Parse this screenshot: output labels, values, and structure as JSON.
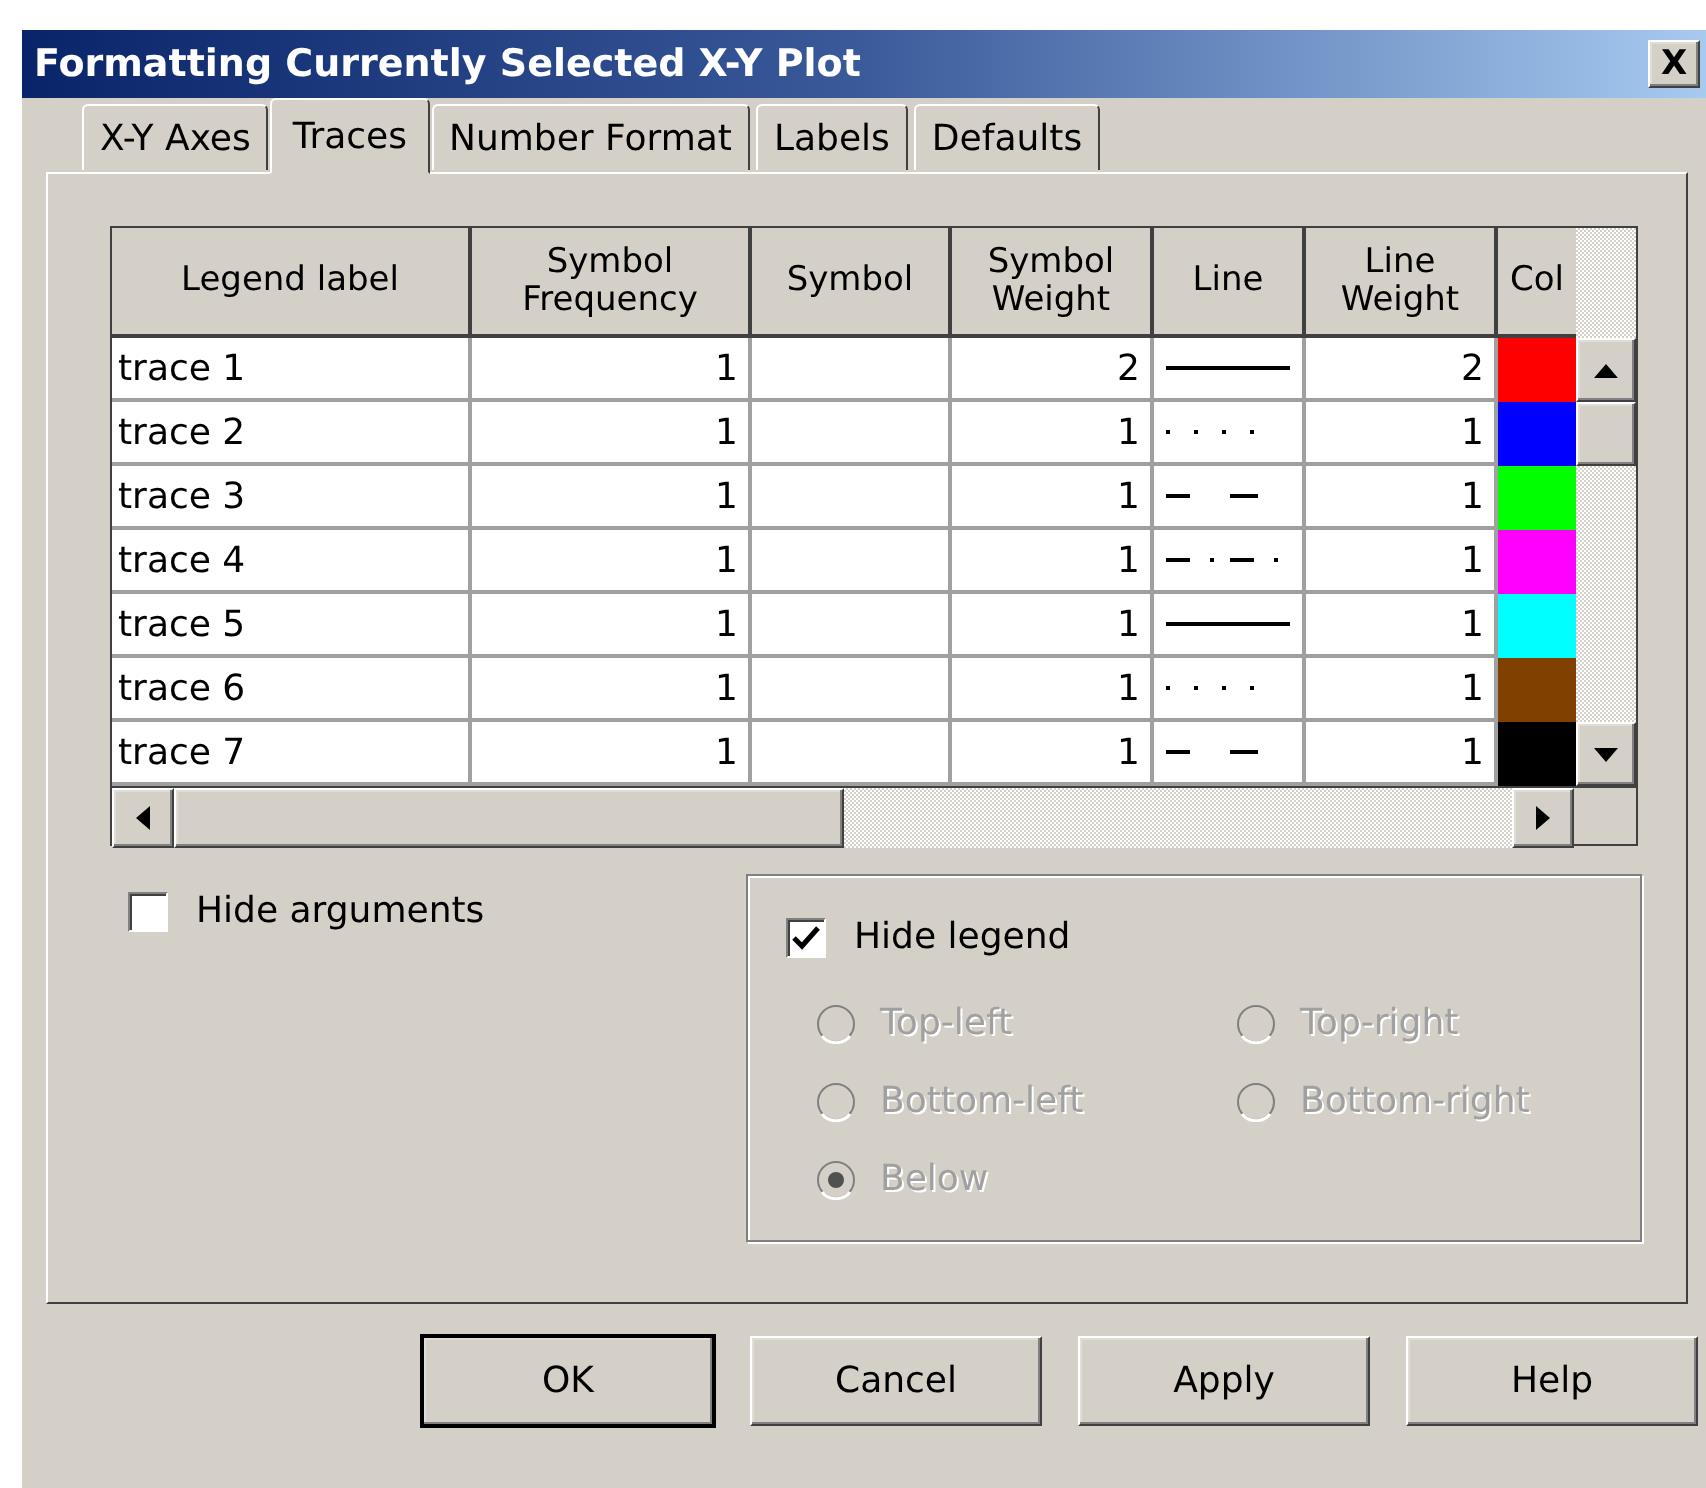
{
  "window": {
    "title": "Formatting Currently Selected X-Y Plot",
    "close": "X"
  },
  "tabs": [
    {
      "label": "X-Y Axes",
      "selected": false
    },
    {
      "label": "Traces",
      "selected": true
    },
    {
      "label": "Number Format",
      "selected": false
    },
    {
      "label": "Labels",
      "selected": false
    },
    {
      "label": "Defaults",
      "selected": false
    }
  ],
  "table": {
    "columns": [
      "Legend label",
      "Symbol Frequency",
      "Symbol",
      "Symbol Weight",
      "Line",
      "Line Weight",
      "Col"
    ],
    "rows": [
      {
        "legend_label": "trace 1",
        "symbol_frequency": "1",
        "symbol_weight": "2",
        "line": {
          "kind": "solid"
        },
        "line_weight": "2",
        "color": "#ff0000"
      },
      {
        "legend_label": "trace 2",
        "symbol_frequency": "1",
        "symbol_weight": "1",
        "line": {
          "kind": "dotted"
        },
        "line_weight": "1",
        "color": "#0000ff"
      },
      {
        "legend_label": "trace 3",
        "symbol_frequency": "1",
        "symbol_weight": "1",
        "line": {
          "kind": "dashed"
        },
        "line_weight": "1",
        "color": "#00ff00"
      },
      {
        "legend_label": "trace 4",
        "symbol_frequency": "1",
        "symbol_weight": "1",
        "line": {
          "kind": "dashdot"
        },
        "line_weight": "1",
        "color": "#ff00ff"
      },
      {
        "legend_label": "trace 5",
        "symbol_frequency": "1",
        "symbol_weight": "1",
        "line": {
          "kind": "solid"
        },
        "line_weight": "1",
        "color": "#00ffff"
      },
      {
        "legend_label": "trace 6",
        "symbol_frequency": "1",
        "symbol_weight": "1",
        "line": {
          "kind": "dotted"
        },
        "line_weight": "1",
        "color": "#804000"
      },
      {
        "legend_label": "trace 7",
        "symbol_frequency": "1",
        "symbol_weight": "1",
        "line": {
          "kind": "dashed"
        },
        "line_weight": "1",
        "color": "#000000"
      }
    ]
  },
  "hide_arguments": {
    "label": "Hide arguments",
    "checked": false
  },
  "legend": {
    "hide": {
      "label": "Hide legend",
      "checked": true
    },
    "disabled": true,
    "positions": [
      {
        "label": "Top-left",
        "selected": false
      },
      {
        "label": "Top-right",
        "selected": false
      },
      {
        "label": "Bottom-left",
        "selected": false
      },
      {
        "label": "Bottom-right",
        "selected": false
      },
      {
        "label": "Below",
        "selected": true
      }
    ]
  },
  "buttons": [
    {
      "label": "OK",
      "default": true
    },
    {
      "label": "Cancel",
      "default": false
    },
    {
      "label": "Apply",
      "default": false
    },
    {
      "label": "Help",
      "default": false
    }
  ]
}
